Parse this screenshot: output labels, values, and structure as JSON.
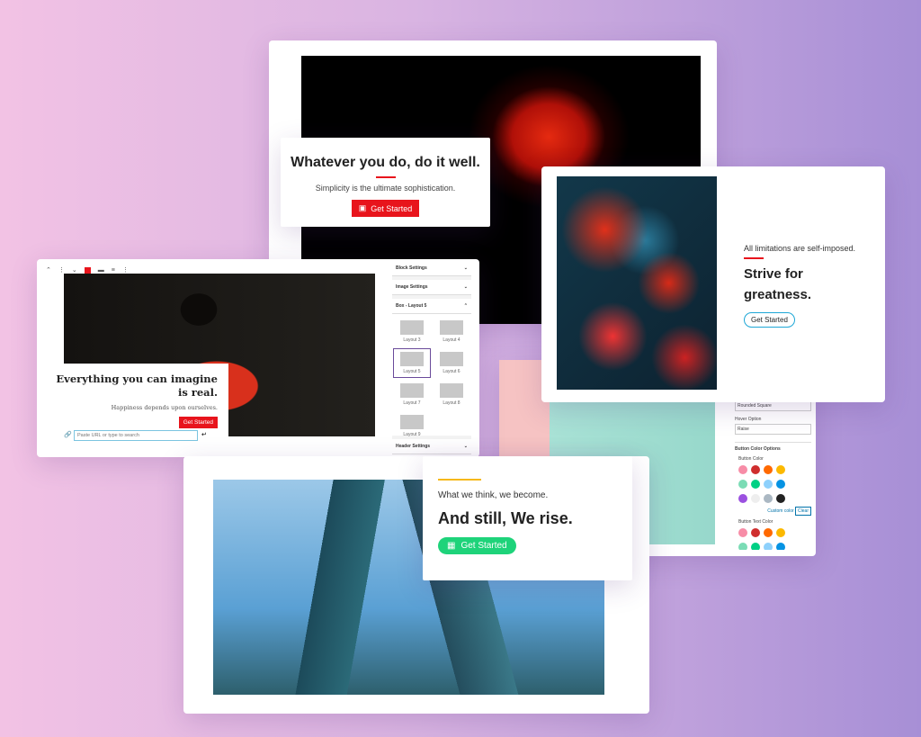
{
  "card_top": {
    "heading": "Whatever you do, do it well.",
    "subheading": "Simplicity is the ultimate sophistication.",
    "button": "Get Started",
    "accent": "#e8141c"
  },
  "card_right": {
    "eyebrow": "All limitations are self-imposed.",
    "heading": "Strive for greatness.",
    "button": "Get Started",
    "accent": "#1ea7d6"
  },
  "editor": {
    "heading": "Everything you can imagine is real.",
    "subheading": "Happiness depends upon ourselves.",
    "button": "Get Started",
    "url_placeholder": "Paste URL or type to search",
    "panel": {
      "block_settings": "Block Settings",
      "image_settings": "Image Settings",
      "box_layout": "Box - Layout 5",
      "header_settings": "Header Settings",
      "layouts": [
        "Layout 3",
        "Layout 4",
        "Layout 5",
        "Layout 6",
        "Layout 7",
        "Layout 8",
        "Layout 9"
      ],
      "selected_layout": "Layout 5"
    }
  },
  "color_panel": {
    "shape_value": "Rounded Square",
    "hover_label": "Hover Option",
    "hover_value": "Raise",
    "section": "Button Color Options",
    "button_color_label": "Button Color",
    "custom_color": "Custom color",
    "clear": "Clear",
    "text_color_label": "Button Text Color",
    "swatches": [
      "#f78da7",
      "#cf2e2e",
      "#ff6900",
      "#fcb900",
      "#7bdcb5",
      "#00d084",
      "#8ed1fc",
      "#0693e3",
      "#9b51e0",
      "#eeeeee",
      "#abb8c3",
      "#222222"
    ]
  },
  "card_bottom": {
    "eyebrow": "What we think, we become.",
    "heading": "And still, We rise.",
    "button": "Get Started",
    "accent": "#1ed37a",
    "bar": "#f6b81a"
  }
}
